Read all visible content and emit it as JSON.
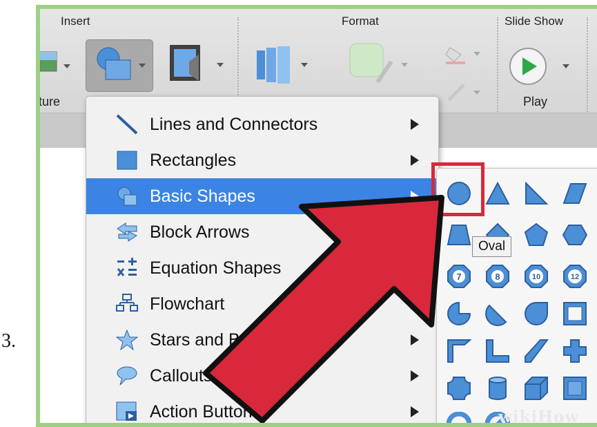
{
  "step_number": "3.",
  "ribbon": {
    "groups": [
      "Insert",
      "Format",
      "Slide Show"
    ],
    "picture_label": "ture",
    "play_label": "Play"
  },
  "menu": {
    "items": [
      {
        "label": "Lines and Connectors",
        "icon": "line-icon"
      },
      {
        "label": "Rectangles",
        "icon": "rectangle-icon"
      },
      {
        "label": "Basic Shapes",
        "icon": "basic-shapes-icon",
        "selected": true
      },
      {
        "label": "Block Arrows",
        "icon": "block-arrow-icon"
      },
      {
        "label": "Equation Shapes",
        "icon": "equation-icon"
      },
      {
        "label": "Flowchart",
        "icon": "flowchart-icon"
      },
      {
        "label": "Stars and Banners",
        "icon": "star-icon"
      },
      {
        "label": "Callouts",
        "icon": "callout-icon"
      },
      {
        "label": "Action Buttons",
        "icon": "action-button-icon"
      }
    ]
  },
  "submenu": {
    "tooltip": "Oval",
    "octagon_numbers": [
      "7",
      "8",
      "10",
      "12"
    ]
  },
  "colors": {
    "frame": "#9fcf85",
    "selection": "#3c84e4",
    "shape_fill": "#4b8fd6",
    "arrow": "#d9283b",
    "highlight": "#d9283b"
  },
  "watermark": "wikiHow"
}
